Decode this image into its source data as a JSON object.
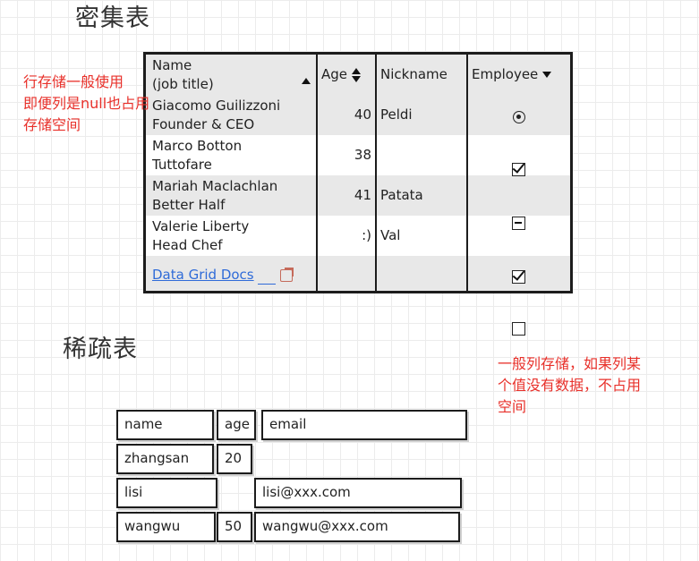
{
  "dense_title": "密集表",
  "sparse_title": "稀疏表",
  "note_row_storage": [
    "行存储一般使用",
    "即便列是null也占用",
    "存储空间"
  ],
  "note_col_storage": [
    "一般列存储，如果列某",
    "个值没有数据，不占用",
    "空间"
  ],
  "grid": {
    "headers": {
      "name_line1": "Name",
      "name_line2": "(job title)",
      "age": "Age",
      "nickname": "Nickname",
      "employee": "Employee"
    },
    "rows": [
      {
        "name": "Giacomo Guilizzoni",
        "title": "Founder & CEO",
        "age": "40",
        "nickname": "Peldi",
        "employee": "radio-selected"
      },
      {
        "name": "Marco Botton",
        "title": "Tuttofare",
        "age": "38",
        "nickname": "",
        "employee": "checked"
      },
      {
        "name": "Mariah Maclachlan",
        "title": "Better Half",
        "age": "41",
        "nickname": "Patata",
        "employee": "indeterminate"
      },
      {
        "name": "Valerie Liberty",
        "title": "Head Chef",
        "age": ":)",
        "nickname": "Val",
        "employee": "checked"
      }
    ],
    "footer_link": "Data Grid Docs",
    "footer_employee": "unchecked"
  },
  "sparse": {
    "row1": {
      "c1": "name",
      "c2": "age",
      "c3": "email"
    },
    "row2": {
      "c1": "zhangsan",
      "c2": "20"
    },
    "row3": {
      "c1": "lisi",
      "c3": "lisi@xxx.com"
    },
    "row4": {
      "c1": "wangwu",
      "c2": "50",
      "c3": "wangwu@xxx.com"
    }
  },
  "colors": {
    "note": "#e8302a",
    "link": "#2f6bd8",
    "row_alt": "#e8e8e8"
  }
}
